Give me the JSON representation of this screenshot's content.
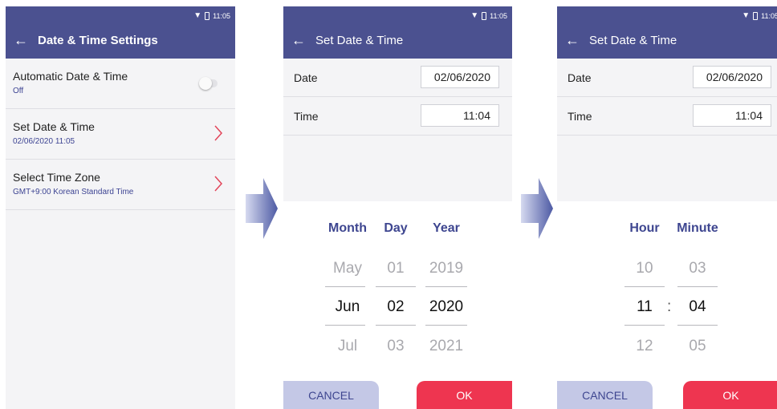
{
  "status": {
    "time": "11:05"
  },
  "screen1": {
    "title": "Date & Time Settings",
    "items": [
      {
        "label": "Automatic Date & Time",
        "sub": "Off"
      },
      {
        "label": "Set Date & Time",
        "sub": "02/06/2020 11:05"
      },
      {
        "label": "Select Time Zone",
        "sub": "GMT+9:00 Korean Standard Time"
      }
    ]
  },
  "screen2": {
    "title": "Set Date & Time",
    "date_label": "Date",
    "date_value": "02/06/2020",
    "time_label": "Time",
    "time_value": "11:04",
    "picker": {
      "month": {
        "head": "Month",
        "prev": "May",
        "cur": "Jun",
        "next": "Jul"
      },
      "day": {
        "head": "Day",
        "prev": "01",
        "cur": "02",
        "next": "03"
      },
      "year": {
        "head": "Year",
        "prev": "2019",
        "cur": "2020",
        "next": "2021"
      }
    },
    "cancel": "CANCEL",
    "ok": "OK"
  },
  "screen3": {
    "title": "Set Date & Time",
    "date_label": "Date",
    "date_value": "02/06/2020",
    "time_label": "Time",
    "time_value": "11:04",
    "picker": {
      "hour": {
        "head": "Hour",
        "prev": "10",
        "cur": "11",
        "next": "12"
      },
      "minute": {
        "head": "Minute",
        "prev": "03",
        "cur": "04",
        "next": "05"
      },
      "separator": ":"
    },
    "cancel": "CANCEL",
    "ok": "OK"
  },
  "colors": {
    "header": "#4b5190",
    "accent_text": "#3e4690",
    "ok": "#ee3550",
    "cancel": "#c4c8e6",
    "chevron": "#e2455a"
  },
  "icons": [
    "wifi-icon",
    "battery-icon",
    "back-arrow-icon",
    "chevron-right-icon",
    "flow-arrow-icon"
  ]
}
